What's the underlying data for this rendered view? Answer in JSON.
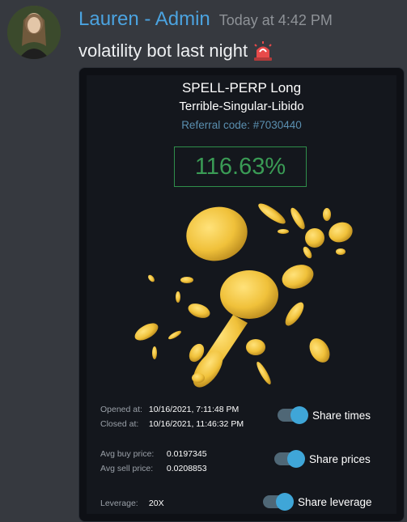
{
  "message": {
    "username": "Lauren - Admin",
    "timestamp": "Today at 4:42 PM",
    "text": "volatility bot last night",
    "emoji": "rotating-light-icon"
  },
  "card": {
    "title": "SPELL-PERP Long",
    "subtitle": "Terrible-Singular-Libido",
    "referral": "Referral code: #7030440",
    "pnl": "116.63%",
    "opened_label": "Opened at:",
    "opened_value": "10/16/2021, 7:11:48 PM",
    "closed_label": "Closed at:",
    "closed_value": "10/16/2021, 11:46:32 PM",
    "avg_buy_label": "Avg buy price:",
    "avg_buy_value": "0.0197345",
    "avg_sell_label": "Avg sell price:",
    "avg_sell_value": "0.0208853",
    "leverage_label": "Leverage:",
    "leverage_value": "20X",
    "toggles": {
      "times": "Share times",
      "prices": "Share prices",
      "leverage": "Share leverage"
    }
  },
  "colors": {
    "username": "#4ba3e0",
    "pnl": "#3a9b55",
    "toggle": "#3fa6d8",
    "coin": "#f0c13a"
  }
}
